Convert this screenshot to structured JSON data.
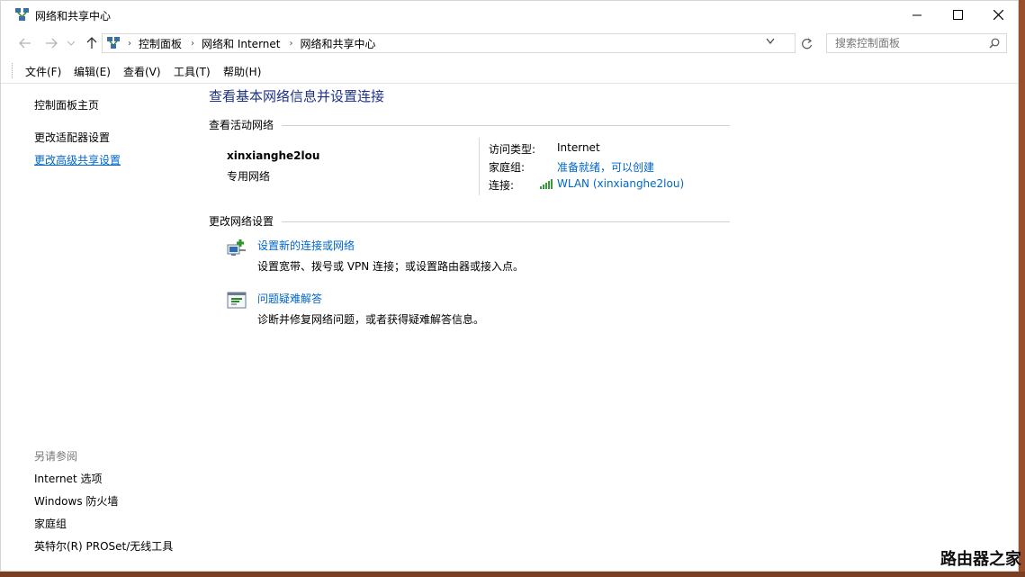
{
  "window": {
    "title": "网络和共享中心"
  },
  "address": {
    "crumbs": [
      "控制面板",
      "网络和 Internet",
      "网络和共享中心"
    ],
    "search_placeholder": "搜索控制面板"
  },
  "menu": {
    "items": [
      "文件(F)",
      "编辑(E)",
      "查看(V)",
      "工具(T)",
      "帮助(H)"
    ]
  },
  "sidebar": {
    "home": "控制面板主页",
    "links": [
      "更改适配器设置",
      "更改高级共享设置"
    ],
    "see_also_heading": "另请参阅",
    "see_also": [
      "Internet 选项",
      "Windows 防火墙",
      "家庭组",
      "英特尔(R) PROSet/无线工具"
    ]
  },
  "main": {
    "title": "查看基本网络信息并设置连接",
    "active_heading": "查看活动网络",
    "network": {
      "name": "xinxianghe2lou",
      "type": "专用网络",
      "access_label": "访问类型:",
      "access_value": "Internet",
      "homegroup_label": "家庭组:",
      "homegroup_value": "准备就绪，可以创建",
      "connection_label": "连接:",
      "connection_value": "WLAN (xinxianghe2lou)"
    },
    "change_heading": "更改网络设置",
    "tasks": [
      {
        "title": "设置新的连接或网络",
        "desc": "设置宽带、拨号或 VPN 连接；或设置路由器或接入点。",
        "icon": "network-setup-icon"
      },
      {
        "title": "问题疑难解答",
        "desc": "诊断并修复网络问题，或者获得疑难解答信息。",
        "icon": "troubleshoot-icon"
      }
    ]
  },
  "watermark": "路由器之家",
  "colors": {
    "link": "#0066cc",
    "heading": "#1e3287",
    "desktop": "#8a4a2a"
  }
}
